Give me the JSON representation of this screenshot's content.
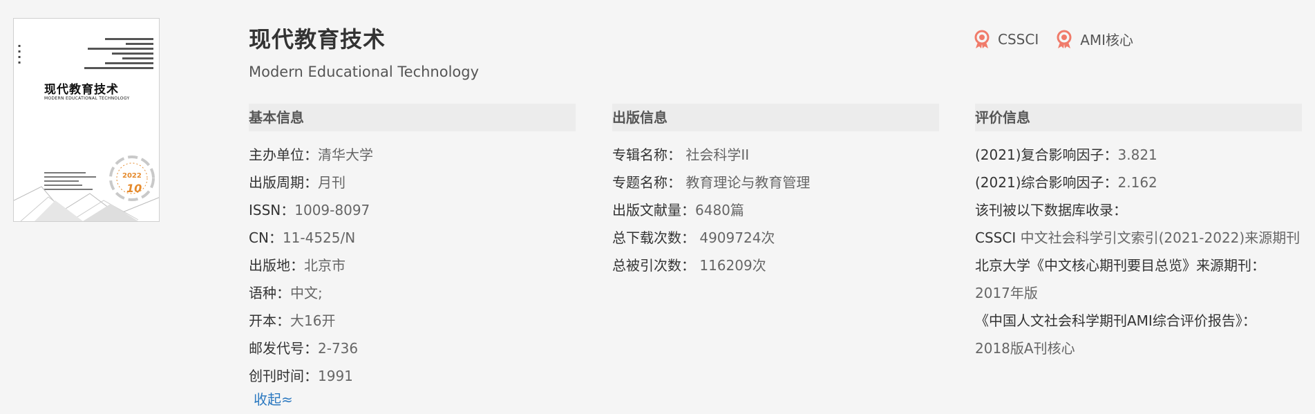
{
  "journal": {
    "title": "现代教育技术",
    "subtitle": "Modern Educational Technology",
    "badges": [
      "CSSCI",
      "AMI核心"
    ],
    "cover": {
      "title": "现代教育技术",
      "en_title": "MODERN EDUCATIONAL TECHNOLOGY",
      "year": "2022",
      "issue": "10"
    }
  },
  "basic": {
    "heading": "基本信息",
    "rows": [
      {
        "label": "主办单位：",
        "value": "清华大学"
      },
      {
        "label": "出版周期：",
        "value": "月刊"
      },
      {
        "label": "ISSN：",
        "value": "1009-8097"
      },
      {
        "label": "CN：",
        "value": "11-4525/N"
      },
      {
        "label": "出版地：",
        "value": "北京市"
      },
      {
        "label": "语种：",
        "value": "中文;"
      },
      {
        "label": "开本：",
        "value": "大16开"
      },
      {
        "label": "邮发代号：",
        "value": "2-736"
      },
      {
        "label": "创刊时间：",
        "value": "1991"
      }
    ],
    "collapse_label": "收起≈"
  },
  "publish": {
    "heading": "出版信息",
    "rows": [
      {
        "label": "专辑名称：",
        "value": "社会科学II"
      },
      {
        "label": "专题名称：",
        "value": "教育理论与教育管理"
      },
      {
        "label": "出版文献量：",
        "value": "6480篇"
      },
      {
        "label": "总下载次数：",
        "value": "4909724次"
      },
      {
        "label": "总被引次数：",
        "value": "116209次"
      }
    ]
  },
  "evaluation": {
    "heading": "评价信息",
    "impact1": {
      "label": "(2021)复合影响因子：",
      "value": "3.821"
    },
    "impact2": {
      "label": "(2021)综合影响因子：",
      "value": "2.162"
    },
    "db_label": "该刊被以下数据库收录：",
    "cssci_name": "CSSCI",
    "cssci_desc": "中文社会科学引文索引(2021-2022)来源期刊",
    "pku_label": "北京大学《中文核心期刊要目总览》来源期刊：",
    "pku_value": "2017年版",
    "ami_label": "《中国人文社会科学期刊AMI综合评价报告》：",
    "ami_value": "2018版A刊核心"
  }
}
